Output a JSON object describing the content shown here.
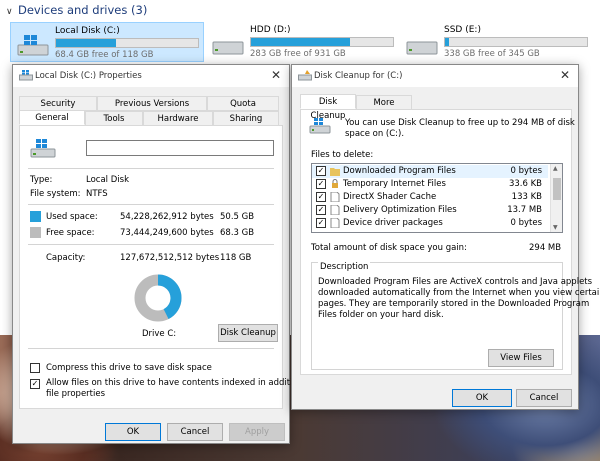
{
  "explorer": {
    "section_title": "Devices and drives (3)",
    "drives": [
      {
        "name": "Local Disk (C:)",
        "free": "68.4 GB free of 118 GB",
        "used_fraction": 0.42,
        "selected": true
      },
      {
        "name": "HDD (D:)",
        "free": "283 GB free of 931 GB",
        "used_fraction": 0.7,
        "selected": false
      },
      {
        "name": "SSD (E:)",
        "free": "338 GB free of 345 GB",
        "used_fraction": 0.03,
        "selected": false
      }
    ]
  },
  "props": {
    "title": "Local Disk (C:) Properties",
    "tabs_row1": [
      "Security",
      "Previous Versions",
      "Quota"
    ],
    "tabs_row2": [
      "General",
      "Tools",
      "Hardware",
      "Sharing"
    ],
    "name_value": "",
    "type_label": "Type:",
    "type_value": "Local Disk",
    "fs_label": "File system:",
    "fs_value": "NTFS",
    "used_label": "Used space:",
    "used_bytes": "54,228,262,912 bytes",
    "used_gb": "50.5 GB",
    "free_label": "Free space:",
    "free_bytes": "73,444,249,600 bytes",
    "free_gb": "68.3 GB",
    "capacity_label": "Capacity:",
    "capacity_bytes": "127,672,512,512 bytes",
    "capacity_gb": "118 GB",
    "drive_label": "Drive C:",
    "cleanup_button": "Disk Cleanup",
    "compress_label": "Compress this drive to save disk space",
    "compress_checked": false,
    "index_label_1": "Allow files on this drive to have contents indexed in addition to",
    "index_label_2": "file properties",
    "index_checked": true,
    "ok": "OK",
    "cancel": "Cancel",
    "apply": "Apply",
    "used_color": "#26a0da",
    "free_color": "#bcbcbc"
  },
  "cleanup": {
    "title": "Disk Cleanup for  (C:)",
    "tabs": [
      "Disk Cleanup",
      "More Options"
    ],
    "intro_1": "You can use Disk Cleanup to free up to 294 MB of disk",
    "intro_2": "space on  (C:).",
    "files_label": "Files to delete:",
    "files": [
      {
        "name": "Downloaded Program Files",
        "size": "0 bytes",
        "checked": true,
        "selected": true
      },
      {
        "name": "Temporary Internet Files",
        "size": "33.6 KB",
        "checked": true,
        "selected": false
      },
      {
        "name": "DirectX Shader Cache",
        "size": "133 KB",
        "checked": true,
        "selected": false
      },
      {
        "name": "Delivery Optimization Files",
        "size": "13.7 MB",
        "checked": true,
        "selected": false
      },
      {
        "name": "Device driver packages",
        "size": "0 bytes",
        "checked": true,
        "selected": false
      }
    ],
    "total_label": "Total amount of disk space you gain:",
    "total_value": "294 MB",
    "desc_legend": "Description",
    "desc_lines": [
      "Downloaded Program Files are ActiveX controls and Java applets",
      "downloaded automatically from the Internet when you view certain",
      "pages. They are temporarily stored in the Downloaded Program",
      "Files folder on your hard disk."
    ],
    "view_files": "View Files",
    "ok": "OK",
    "cancel": "Cancel"
  }
}
